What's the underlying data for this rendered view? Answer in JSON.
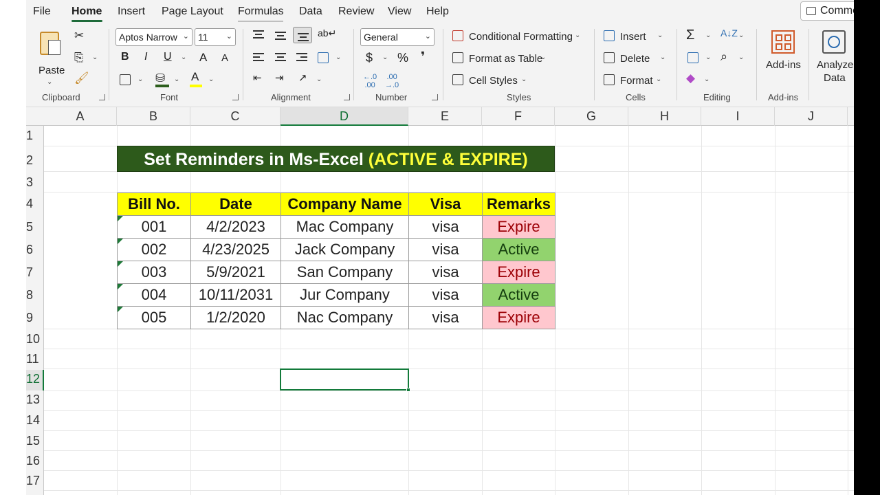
{
  "menu": {
    "items": [
      "File",
      "Home",
      "Insert",
      "Page Layout",
      "Formulas",
      "Data",
      "Review",
      "View",
      "Help"
    ],
    "active": "Home",
    "comments_label": "Comme"
  },
  "ribbon": {
    "clipboard": {
      "paste": "Paste",
      "group": "Clipboard"
    },
    "font": {
      "name": "Aptos Narrow",
      "size": "11",
      "group": "Font",
      "bold": "B",
      "italic": "I",
      "underline": "U",
      "grow": "A",
      "shrink": "A"
    },
    "alignment": {
      "group": "Alignment"
    },
    "number": {
      "format": "General",
      "group": "Number",
      "currency": "$",
      "percent": "%",
      "comma": "❜"
    },
    "styles": {
      "conditional": "Conditional Formatting",
      "format_table": "Format as Table",
      "cell_styles": "Cell Styles",
      "group": "Styles"
    },
    "cells": {
      "insert": "Insert",
      "delete": "Delete",
      "format": "Format",
      "group": "Cells"
    },
    "editing": {
      "group": "Editing"
    },
    "addins": {
      "label": "Add-ins",
      "group": "Add-ins"
    },
    "analyze": {
      "line1": "Analyze",
      "line2": "Data"
    }
  },
  "grid": {
    "columns": [
      "A",
      "B",
      "C",
      "D",
      "E",
      "F",
      "G",
      "H",
      "I",
      "J"
    ],
    "rows": [
      "1",
      "2",
      "3",
      "4",
      "5",
      "6",
      "7",
      "8",
      "9",
      "10",
      "11",
      "12",
      "13",
      "14",
      "15",
      "16",
      "17"
    ],
    "selected_column": "D",
    "selected_row": "12"
  },
  "sheet": {
    "title_main": "Set Reminders in Ms-Excel ",
    "title_highlight": "(ACTIVE & EXPIRE)",
    "headers": [
      "Bill No.",
      "Date",
      "Company Name",
      "Visa",
      "Remarks"
    ],
    "rows": [
      {
        "bill": "001",
        "date": "4/2/2023",
        "company": "Mac Company",
        "visa": "visa",
        "remark": "Expire"
      },
      {
        "bill": "002",
        "date": "4/23/2025",
        "company": "Jack Company",
        "visa": "visa",
        "remark": "Active"
      },
      {
        "bill": "003",
        "date": "5/9/2021",
        "company": "San Company",
        "visa": "visa",
        "remark": "Expire"
      },
      {
        "bill": "004",
        "date": "10/11/2031",
        "company": "Jur Company",
        "visa": "visa",
        "remark": "Active"
      },
      {
        "bill": "005",
        "date": "1/2/2020",
        "company": "Nac Company",
        "visa": "visa",
        "remark": "Expire"
      }
    ]
  },
  "colors": {
    "title_bg": "#2d5a1b",
    "header_bg": "#ffff00",
    "expire_bg": "#ffc7ce",
    "active_bg": "#92d36e",
    "accent": "#137a3a"
  }
}
